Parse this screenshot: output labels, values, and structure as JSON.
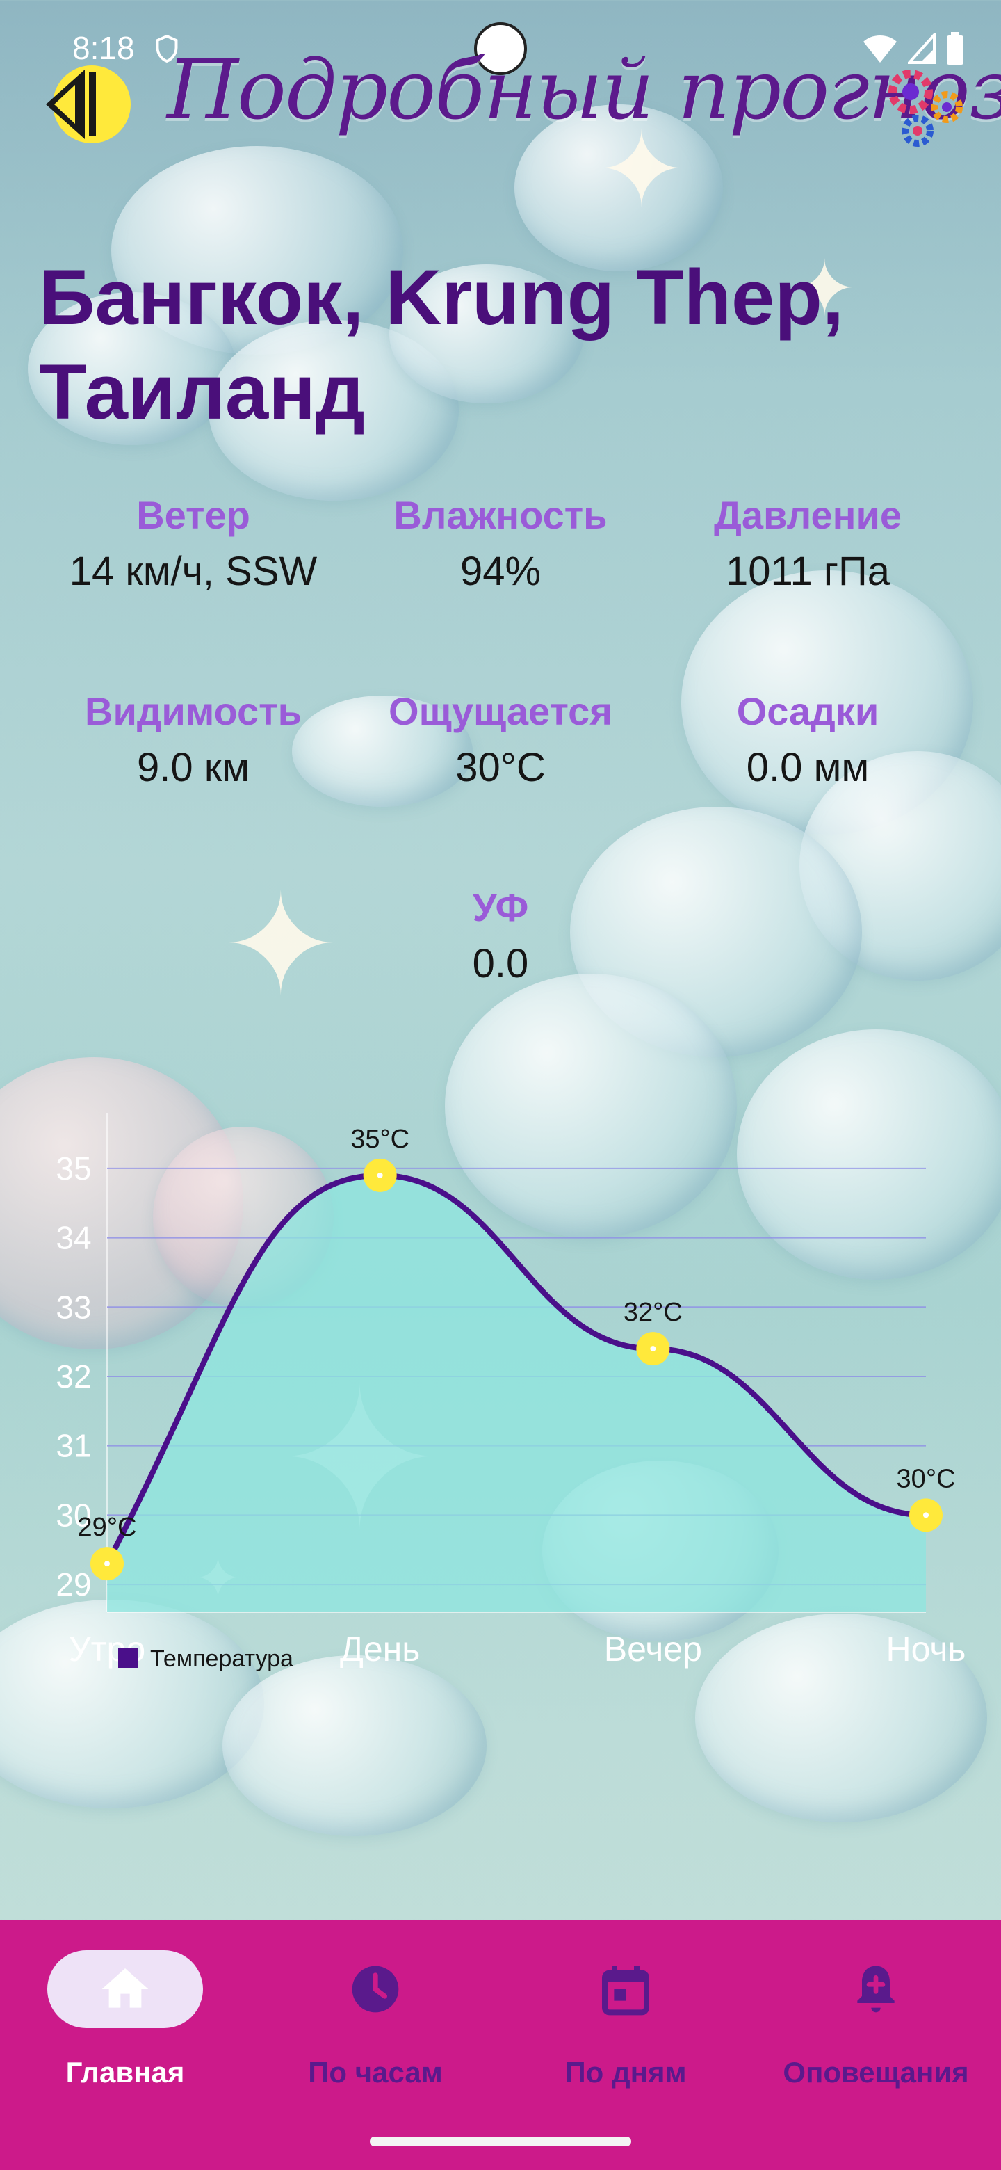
{
  "status_bar": {
    "time": "8:18",
    "icons": [
      "shield-icon",
      "wifi-icon",
      "signal-icon",
      "battery-icon"
    ]
  },
  "header": {
    "title": "Подробный прогноз",
    "back_icon": "back-arrow-icon",
    "settings_icon": "gears-icon"
  },
  "location": {
    "name": "Бангкок, Krung Thep, Таиланд"
  },
  "stats": [
    {
      "label": "Ветер",
      "value": "14 км/ч, SSW"
    },
    {
      "label": "Влажность",
      "value": "94%"
    },
    {
      "label": "Давление",
      "value": "1011 гПа"
    },
    {
      "label": "Видимость",
      "value": "9.0 км"
    },
    {
      "label": "Ощущается",
      "value": "30°C"
    },
    {
      "label": "Осадки",
      "value": "0.0 мм"
    },
    {
      "label": "УФ",
      "value": "0.0"
    }
  ],
  "chart_data": {
    "type": "line",
    "title": "",
    "xlabel": "",
    "ylabel": "",
    "categories": [
      "Утро",
      "День",
      "Вечер",
      "Ночь"
    ],
    "series": [
      {
        "name": "Температура",
        "values": [
          29.3,
          34.9,
          32.4,
          30.0
        ],
        "point_labels": [
          "29°C",
          "35°C",
          "32°C",
          "30°C"
        ]
      }
    ],
    "ylim": [
      28.7,
      35.4
    ],
    "yticks": [
      "29",
      "30",
      "31",
      "32",
      "33",
      "34",
      "35"
    ],
    "grid": true,
    "legend": "bottom-left",
    "colors": {
      "line": "#4a0f8a",
      "fill": "#8ee6df",
      "point": "#ffe93b",
      "grid": "#8f8fe6"
    }
  },
  "bottom_nav": {
    "items": [
      {
        "label": "Главная",
        "icon": "home-icon",
        "active": true
      },
      {
        "label": "По часам",
        "icon": "clock-icon",
        "active": false
      },
      {
        "label": "По дням",
        "icon": "calendar-icon",
        "active": false
      },
      {
        "label": "Оповещания",
        "icon": "bell-plus-icon",
        "active": false
      }
    ]
  },
  "colors": {
    "accent": "#5c1a8c",
    "label": "#9a5bd8",
    "nav_bg": "#cc1a8a",
    "nav_active_pill": "#eee2f7"
  }
}
